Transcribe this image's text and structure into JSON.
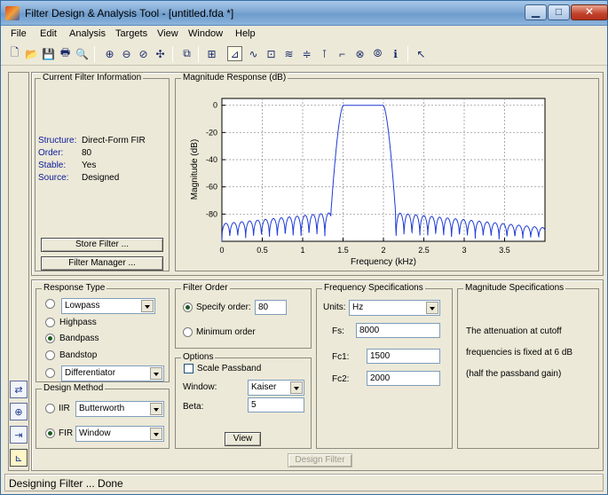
{
  "window": {
    "title": "Filter Design & Analysis Tool -  [untitled.fda *]",
    "min_glyph": "▁",
    "max_glyph": "□",
    "close_glyph": "✕"
  },
  "menu": {
    "items": [
      "File",
      "Edit",
      "Analysis",
      "Targets",
      "View",
      "Window",
      "Help"
    ]
  },
  "current_filter": {
    "title": "Current Filter Information",
    "rows": [
      {
        "key": "Structure:",
        "value": "Direct-Form FIR"
      },
      {
        "key": "Order:",
        "value": "80"
      },
      {
        "key": "Stable:",
        "value": "Yes"
      },
      {
        "key": "Source:",
        "value": "Designed"
      }
    ],
    "store_button": "Store Filter ...",
    "manager_button": "Filter Manager ..."
  },
  "magnitude_response": {
    "title": "Magnitude Response (dB)"
  },
  "chart_data": {
    "type": "line",
    "title": "",
    "xlabel": "Frequency (kHz)",
    "ylabel": "Magnitude (dB)",
    "xlim": [
      0,
      4
    ],
    "ylim": [
      -100,
      5
    ],
    "x_ticks": [
      0,
      0.5,
      1,
      1.5,
      2,
      2.5,
      3,
      3.5
    ],
    "x_tick_labels": [
      "0",
      "0.5",
      "1",
      "1.5",
      "2",
      "2.5",
      "3",
      "3.5"
    ],
    "y_ticks": [
      0,
      -20,
      -40,
      -60,
      -80
    ],
    "y_tick_labels": [
      "0",
      "-20",
      "-40",
      "-60",
      "-80"
    ],
    "grid": true,
    "line_color": "#1f3bd6",
    "series": [
      {
        "passband_khz": [
          1.5,
          2.0
        ],
        "transition_edges_khz": [
          1.35,
          2.15
        ],
        "stopband_sidelobe_peak_db": -79,
        "stopband_floor_db": -100
      }
    ]
  },
  "response_type": {
    "title": "Response Type",
    "options": [
      {
        "label": "Lowpass",
        "selected": false,
        "dropdown": true
      },
      {
        "label": "Highpass",
        "selected": false,
        "dropdown": false
      },
      {
        "label": "Bandpass",
        "selected": true,
        "dropdown": false
      },
      {
        "label": "Bandstop",
        "selected": false,
        "dropdown": false
      },
      {
        "label": "Differentiator",
        "selected": false,
        "dropdown": true
      }
    ]
  },
  "design_method": {
    "title": "Design Method",
    "iir_label": "IIR",
    "iir_value": "Butterworth",
    "fir_label": "FIR",
    "fir_value": "Window",
    "selected": "FIR"
  },
  "filter_order": {
    "title": "Filter Order",
    "specify_label": "Specify order:",
    "specify_value": "80",
    "minimum_label": "Minimum order",
    "selected": "specify"
  },
  "options": {
    "title": "Options",
    "scale_passband_label": "Scale Passband",
    "scale_passband_checked": false,
    "window_label": "Window:",
    "window_value": "Kaiser",
    "beta_label": "Beta:",
    "beta_value": "5",
    "view_button": "View"
  },
  "frequency_specs": {
    "title": "Frequency Specifications",
    "units_label": "Units:",
    "units_value": "Hz",
    "fs_label": "Fs:",
    "fs_value": "8000",
    "fc1_label": "Fc1:",
    "fc1_value": "1500",
    "fc2_label": "Fc2:",
    "fc2_value": "2000"
  },
  "magnitude_specs": {
    "title": "Magnitude Specifications",
    "line1": "The attenuation at cutoff",
    "line2": "frequencies is fixed at 6 dB",
    "line3": "(half the passband gain)"
  },
  "design_button": "Design Filter",
  "status": "Designing Filter ... Done"
}
